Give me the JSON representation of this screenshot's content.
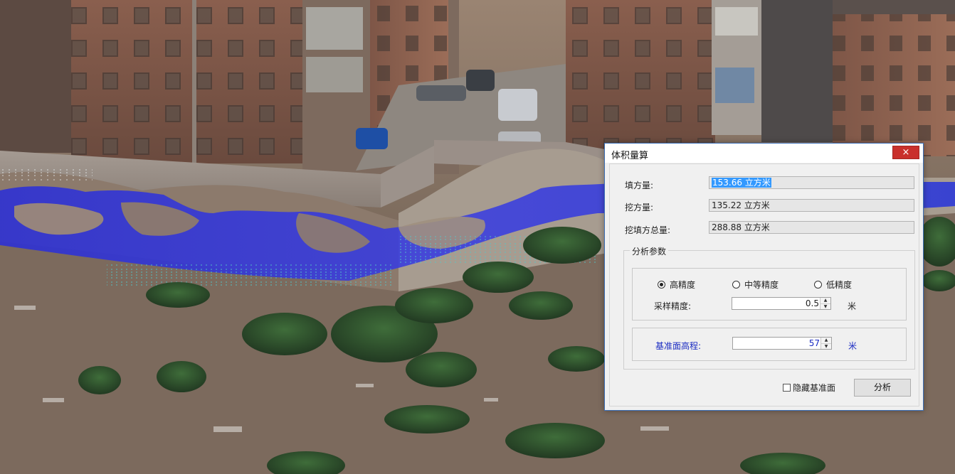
{
  "dialog": {
    "title": "体积量算",
    "close_icon": "×",
    "results": {
      "fill": {
        "label": "填方量:",
        "value": "153.66 立方米"
      },
      "cut": {
        "label": "挖方量:",
        "value": "135.22 立方米"
      },
      "total": {
        "label": "挖填方总量:",
        "value": "288.88 立方米"
      }
    },
    "params": {
      "group_title": "分析参数",
      "precision": {
        "options": [
          "高精度",
          "中等精度",
          "低精度"
        ],
        "selected": "高精度"
      },
      "sampling": {
        "label": "采样精度:",
        "value": "0.5",
        "unit": "米"
      },
      "datum": {
        "label": "基准面高程:",
        "value": "57",
        "unit": "米"
      }
    },
    "hide_datum": {
      "label": "隐藏基准面",
      "checked": false
    },
    "analyze_button": "分析"
  },
  "colors": {
    "fill_surface": "#2430d8",
    "datum_label": "#1a2bc2",
    "close_button": "#c9302c",
    "selection": "#3399ff",
    "dialog_border": "#3d6fb6"
  }
}
